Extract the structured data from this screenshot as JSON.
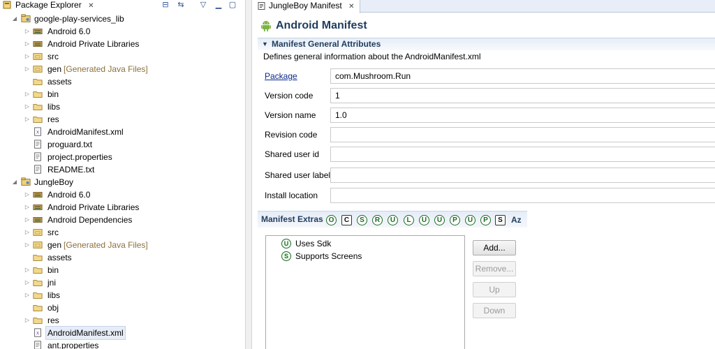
{
  "package_explorer": {
    "tab_label": "Package Explorer",
    "tab_close": "✕",
    "tree": [
      {
        "label": "google-play-services_lib",
        "icon": "project-icon",
        "expanded": true
      },
      {
        "label": "Android 6.0",
        "icon": "library-icon"
      },
      {
        "label": "Android Private Libraries",
        "icon": "library-icon"
      },
      {
        "label": "src",
        "icon": "source-folder-icon"
      },
      {
        "label": "gen",
        "decoration": "[Generated Java Files]",
        "icon": "source-folder-icon"
      },
      {
        "label": "assets",
        "icon": "folder-icon"
      },
      {
        "label": "bin",
        "icon": "folder-icon"
      },
      {
        "label": "libs",
        "icon": "folder-icon"
      },
      {
        "label": "res",
        "icon": "folder-icon"
      },
      {
        "label": "AndroidManifest.xml",
        "icon": "xml-file-icon"
      },
      {
        "label": "proguard.txt",
        "icon": "text-file-icon"
      },
      {
        "label": "project.properties",
        "icon": "text-file-icon"
      },
      {
        "label": "README.txt",
        "icon": "text-file-icon"
      },
      {
        "label": "JungleBoy",
        "icon": "project-icon",
        "expanded": true
      },
      {
        "label": "Android 6.0",
        "icon": "library-icon"
      },
      {
        "label": "Android Private Libraries",
        "icon": "library-icon"
      },
      {
        "label": "Android Dependencies",
        "icon": "library-icon"
      },
      {
        "label": "src",
        "icon": "source-folder-icon"
      },
      {
        "label": "gen",
        "decoration": "[Generated Java Files]",
        "icon": "source-folder-icon"
      },
      {
        "label": "assets",
        "icon": "folder-icon"
      },
      {
        "label": "bin",
        "icon": "folder-icon"
      },
      {
        "label": "jni",
        "icon": "folder-icon"
      },
      {
        "label": "libs",
        "icon": "folder-icon"
      },
      {
        "label": "obj",
        "icon": "folder-icon"
      },
      {
        "label": "res",
        "icon": "folder-icon"
      },
      {
        "label": "AndroidManifest.xml",
        "icon": "xml-file-icon",
        "selected": true
      },
      {
        "label": "ant.properties",
        "icon": "text-file-icon"
      }
    ]
  },
  "editor": {
    "tab_label": "JungleBoy Manifest",
    "tab_close": "✕",
    "title": "Android Manifest",
    "section": {
      "title": "Manifest General Attributes",
      "description": "Defines general information about the AndroidManifest.xml",
      "fields": [
        {
          "label": "Package",
          "value": "com.Mushroom.Run",
          "link": true
        },
        {
          "label": "Version code",
          "value": "1"
        },
        {
          "label": "Version name",
          "value": "1.0"
        },
        {
          "label": "Revision code",
          "value": ""
        },
        {
          "label": "Shared user id",
          "value": ""
        },
        {
          "label": "Shared user label",
          "value": ""
        },
        {
          "label": "Install location",
          "value": ""
        }
      ]
    },
    "extras": {
      "title": "Manifest Extras",
      "filters": [
        "O",
        "C",
        "S",
        "R",
        "U",
        "L",
        "U",
        "U",
        "P",
        "U",
        "P",
        "S"
      ],
      "sort_label": "Az",
      "items": [
        {
          "badge": "U",
          "label": "Uses Sdk"
        },
        {
          "badge": "S",
          "label": "Supports Screens"
        }
      ],
      "buttons": {
        "add": "Add...",
        "remove": "Remove...",
        "up": "Up",
        "down": "Down"
      }
    }
  },
  "colors": {
    "section_title": "#1f3c5e",
    "link": "#0b2a8a",
    "badge": "#1c6b22",
    "decoration": "#8c6f3c"
  }
}
